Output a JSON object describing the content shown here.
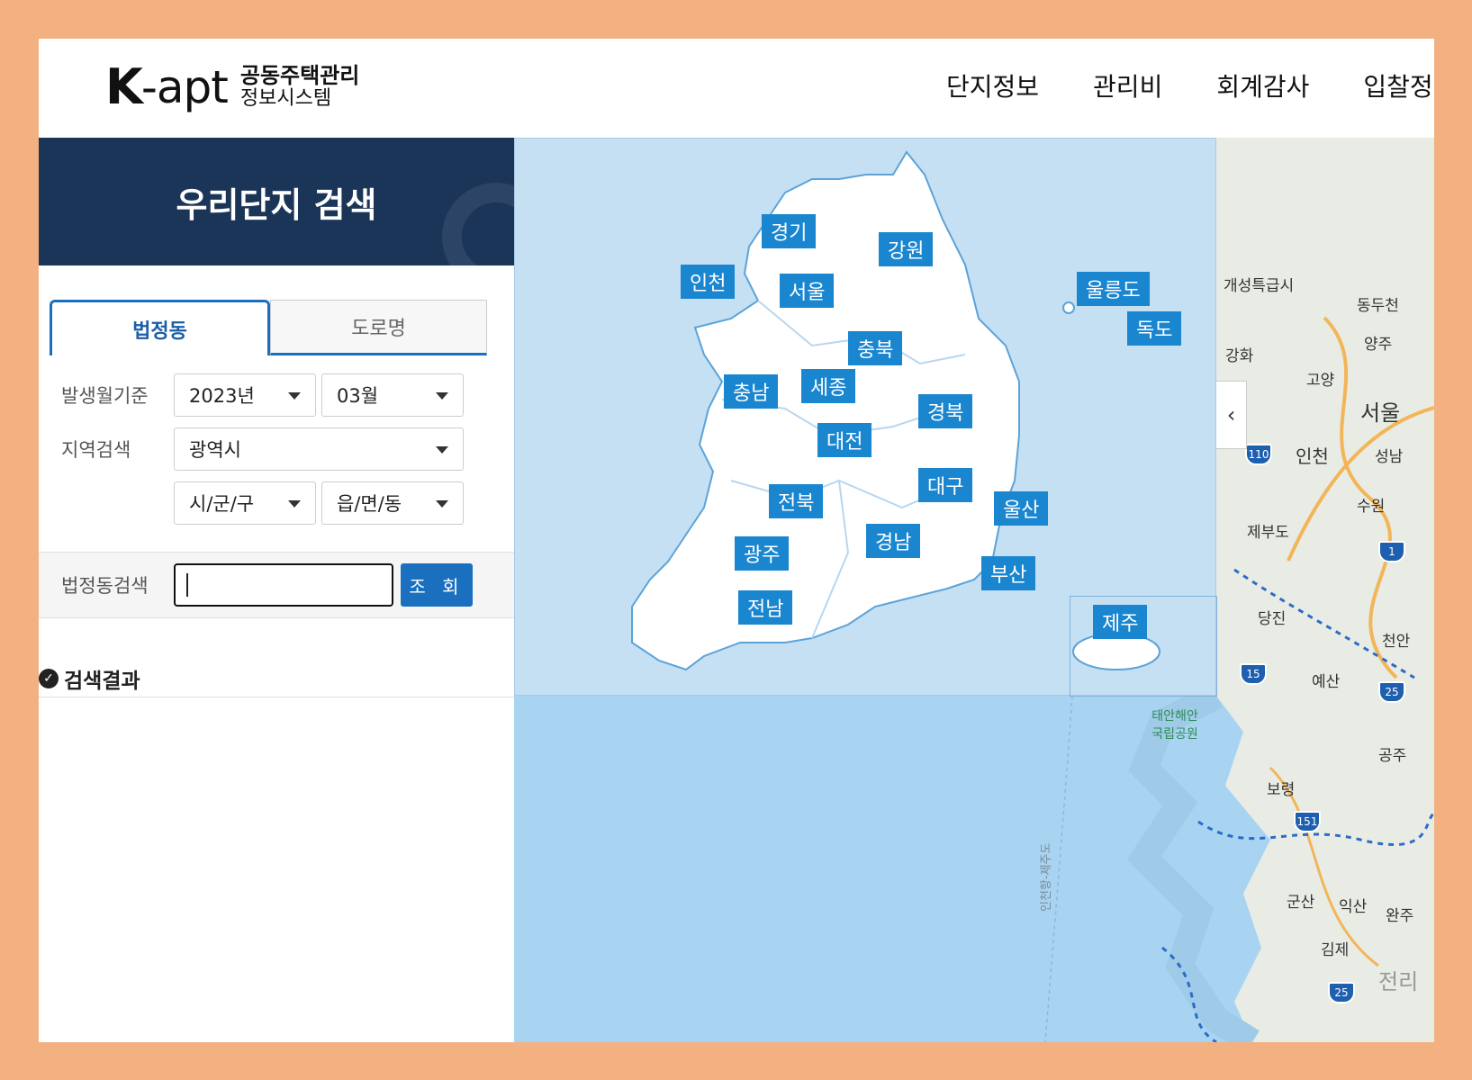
{
  "header": {
    "logo_k": "K",
    "logo_apt": "-apt",
    "logo_line1": "공동주택관리",
    "logo_line2": "정보시스템",
    "nav": [
      "단지정보",
      "관리비",
      "회계감사",
      "입찰정"
    ]
  },
  "panel": {
    "title": "우리단지 검색",
    "tabs": [
      "법정동",
      "도로명"
    ],
    "period_label": "발생월기준",
    "year": "2023년",
    "month": "03월",
    "region_label": "지역검색",
    "province": "광역시",
    "district": "시/군/구",
    "town": "읍/면/동",
    "search_label": "법정동검색",
    "search_value": "",
    "search_button": "조 회",
    "result_title": "검색결과"
  },
  "map": {
    "regions": [
      "경기",
      "강원",
      "인천",
      "서울",
      "울릉도",
      "독도",
      "충북",
      "충남",
      "세종",
      "경북",
      "대전",
      "대구",
      "전북",
      "울산",
      "경남",
      "광주",
      "부산",
      "전남",
      "제주"
    ],
    "places": [
      "개성특급시",
      "동두천",
      "양주",
      "강화",
      "고양",
      "서울",
      "인천",
      "성남",
      "수원",
      "제부도",
      "당진",
      "천안",
      "예산",
      "공주",
      "보령",
      "태안해안 국립공원",
      "군산",
      "익산",
      "김제",
      "전리",
      "완주",
      "인천항-제주도"
    ],
    "route_numbers": [
      "110",
      "1",
      "15",
      "25",
      "151",
      "25"
    ],
    "collapse_icon": "chevron-left"
  }
}
